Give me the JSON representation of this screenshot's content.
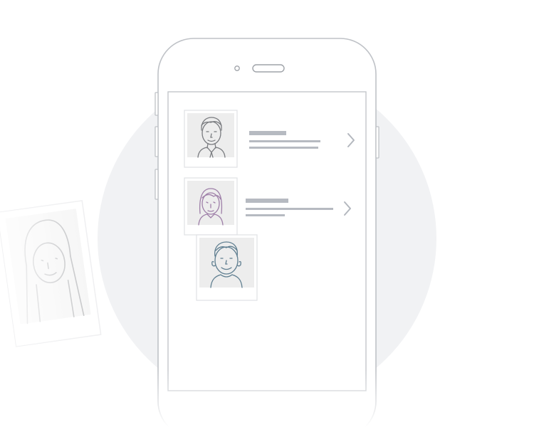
{
  "illustration": {
    "colors": {
      "background": "#ffffff",
      "circle": "#f1f2f4",
      "phone_outline": "#bfc2c7",
      "screen_border": "#c3c6cb",
      "placeholder_text": "#b6bac1",
      "chevron": "#b3b7be",
      "photo_frame": "#ffffff",
      "photo_bg": "#ededed",
      "avatar_line": "#7a7c80"
    },
    "contacts": [
      {
        "avatar": "man-with-tie-avatar",
        "has_chevron": true
      },
      {
        "avatar": "woman-avatar",
        "has_chevron": true
      }
    ],
    "loose_photos": [
      "boy-avatar",
      "woman-faded-avatar"
    ]
  }
}
